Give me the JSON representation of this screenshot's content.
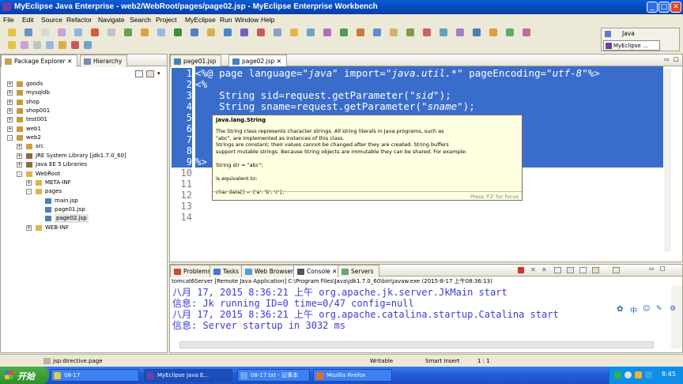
{
  "window": {
    "title": "MyEclipse Java Enterprise - web2/WebRoot/pages/page02.jsp - MyEclipse Enterprise Workbench"
  },
  "menu": [
    "File",
    "Edit",
    "Source",
    "Refactor",
    "Navigate",
    "Search",
    "Project",
    "MyEclipse",
    "Run",
    "Window",
    "Help"
  ],
  "perspectives": {
    "java": "Java",
    "myeclipse": "MyEclipse ..."
  },
  "package_explorer": {
    "tabs": [
      "Package Explorer",
      "Hierarchy"
    ],
    "tree": [
      {
        "label": "goods",
        "level": 0,
        "toggle": "+",
        "icon": "project"
      },
      {
        "label": "mysqldb",
        "level": 0,
        "toggle": "+",
        "icon": "project"
      },
      {
        "label": "shop",
        "level": 0,
        "toggle": "+",
        "icon": "project"
      },
      {
        "label": "shop001",
        "level": 0,
        "toggle": "+",
        "icon": "project"
      },
      {
        "label": "test001",
        "level": 0,
        "toggle": "+",
        "icon": "project"
      },
      {
        "label": "web1",
        "level": 0,
        "toggle": "+",
        "icon": "project"
      },
      {
        "label": "web2",
        "level": 0,
        "toggle": "-",
        "icon": "project"
      },
      {
        "label": "src",
        "level": 1,
        "toggle": "+",
        "icon": "srcfolder"
      },
      {
        "label": "JRE System Library [jdk1.7.0_60]",
        "level": 1,
        "toggle": "+",
        "icon": "library"
      },
      {
        "label": "Java EE 5 Libraries",
        "level": 1,
        "toggle": "+",
        "icon": "library"
      },
      {
        "label": "WebRoot",
        "level": 1,
        "toggle": "-",
        "icon": "folder"
      },
      {
        "label": "META-INF",
        "level": 2,
        "toggle": "+",
        "icon": "folder"
      },
      {
        "label": "pages",
        "level": 2,
        "toggle": "-",
        "icon": "folder"
      },
      {
        "label": "main.jsp",
        "level": 3,
        "toggle": "",
        "icon": "jsp"
      },
      {
        "label": "page01.jsp",
        "level": 3,
        "toggle": "",
        "icon": "jsp"
      },
      {
        "label": "page02.jsp",
        "level": 3,
        "toggle": "",
        "icon": "jsp",
        "selected": true
      },
      {
        "label": "WEB-INF",
        "level": 2,
        "toggle": "+",
        "icon": "folder"
      }
    ]
  },
  "editor": {
    "tabs": [
      "page01.jsp",
      "page02.jsp"
    ],
    "line_numbers": [
      "1",
      "2",
      "3",
      "4",
      "5",
      "6",
      "7",
      "8",
      "9",
      "10",
      "11",
      "12",
      "13",
      "14"
    ],
    "lines": [
      {
        "segments": [
          {
            "t": "<%@ page language="
          },
          {
            "t": "\"java\"",
            "s": true
          },
          {
            "t": " import="
          },
          {
            "t": "\"java.util.*\"",
            "s": true
          },
          {
            "t": " pageEncoding="
          },
          {
            "t": "\"utf-8\"",
            "s": true
          },
          {
            "t": "%>"
          }
        ]
      },
      {
        "segments": [
          {
            "t": "<%"
          }
        ]
      },
      {
        "segments": [
          {
            "t": "    String sid=request.getParameter("
          },
          {
            "t": "\"sid\"",
            "s": true
          },
          {
            "t": ");"
          }
        ]
      },
      {
        "segments": [
          {
            "t": "    String sname=request.getParameter("
          },
          {
            "t": "\"sname\"",
            "s": true
          },
          {
            "t": ");"
          }
        ]
      },
      {
        "segments": [
          {
            "t": ""
          }
        ]
      },
      {
        "segments": [
          {
            "t": ""
          }
        ]
      },
      {
        "segments": [
          {
            "t": ""
          }
        ]
      },
      {
        "segments": [
          {
            "t": ""
          }
        ]
      },
      {
        "segments": [
          {
            "t": "%>"
          }
        ]
      }
    ]
  },
  "tooltip": {
    "title": "java.lang.String",
    "lines": [
      "The String class represents character strings. All string literals in Java programs, such as",
      " \"abc\", are implemented as instances of this class.",
      "Strings are constant; their values cannot be changed after they are created. String buffers",
      " support mutable strings. Because String objects are immutable they can be shared. For example:",
      "",
      "        String str = \"abc\";",
      "",
      "is equivalent to:",
      "",
      "        char data[] = {'a', 'b', 'c'};"
    ],
    "footer": "Press 'F2' for focus"
  },
  "bottom_panel": {
    "tabs": [
      "Problems",
      "Tasks",
      "Web Browser",
      "Console",
      "Servers"
    ],
    "console_header": "tomcat6Server [Remote Java Application] C:\\Program Files\\Java\\jdk1.7.0_60\\bin\\javaw.exe (2015-8-17 上午08:36:13)",
    "console_lines": [
      "八月 17, 2015 8:36:21 上午 org.apache.jk.server.JkMain start",
      "信息: Jk running ID=0 time=0/47  config=null",
      "八月 17, 2015 8:36:21 上午 org.apache.catalina.startup.Catalina start",
      "信息: Server startup in 3032 ms"
    ]
  },
  "status_bar": {
    "path": "jsp:directive.page",
    "mode": "Writable",
    "insert": "Smart Insert",
    "position": "1 : 1"
  },
  "taskbar": {
    "start_label": "开始",
    "items": [
      {
        "label": "08-17",
        "icon_color": "#e9c84b"
      },
      {
        "label": "MyEclipse Java E...",
        "icon_color": "#6a3fa8",
        "active": true
      },
      {
        "label": "08-17.txt - 记事本",
        "icon_color": "#6fa7e0"
      },
      {
        "label": "Mozilla Firefox",
        "icon_color": "#e86c1f"
      }
    ],
    "ime_label": "中",
    "clock": "8:45"
  }
}
